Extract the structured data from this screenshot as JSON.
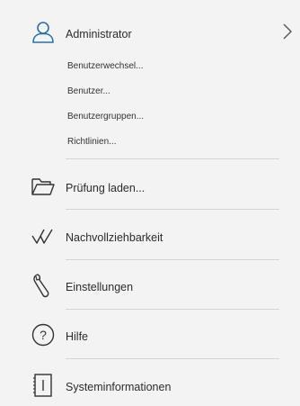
{
  "admin": {
    "title": "Administrator",
    "sub_items": [
      {
        "label": "Benutzerwechsel..."
      },
      {
        "label": "Benutzer..."
      },
      {
        "label": "Benutzergruppen..."
      },
      {
        "label": "Richtlinien..."
      }
    ]
  },
  "items": [
    {
      "label": "Prüfung laden...",
      "icon": "folder-icon"
    },
    {
      "label": "Nachvollziehbarkeit",
      "icon": "traceability-checkmark-icon"
    },
    {
      "label": "Einstellungen",
      "icon": "wrench-icon"
    },
    {
      "label": "Hilfe",
      "icon": "help-question-icon"
    },
    {
      "label": "Systeminformationen",
      "icon": "system-info-icon"
    }
  ],
  "colors": {
    "accent": "#2a6fa8",
    "background": "#f3f3f3",
    "text": "#2b2b2b",
    "divider": "#d3d3d3"
  }
}
